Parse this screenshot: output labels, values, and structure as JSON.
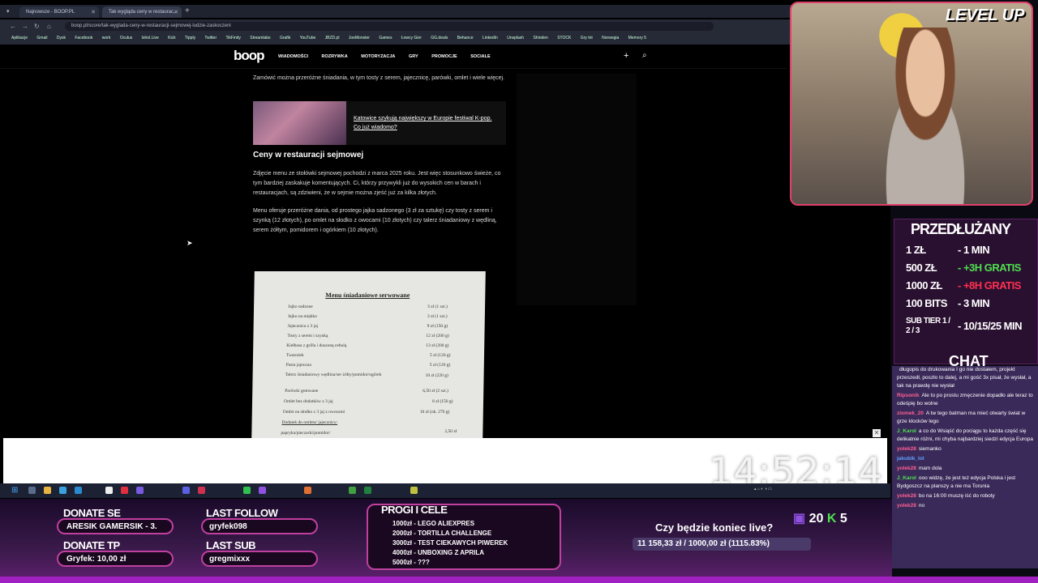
{
  "browser": {
    "tabs": [
      {
        "label": "Najnowsze - BOOP.PL"
      },
      {
        "label": "Tak wygląda ceny w restaurac..."
      }
    ],
    "url": "boop.pl/score/tak-wyglada-ceny-w-restauracji-sejmowej-ludzie-zaskoczeni",
    "bookmarks": [
      "Aplikacje",
      "Gmail",
      "Dysk",
      "Facebook",
      "work",
      "Oculus",
      "lolrol.Live",
      "Kick",
      "Tipply",
      "Twitter",
      "TikFinity",
      "Streamlabs",
      "Grafik",
      "YouTube",
      "JBZD.pl",
      "JoeMonster",
      "Games",
      "Łowcy Gier",
      "GG.deals",
      "Behance",
      "LinkedIn",
      "Unsplash",
      "Shinden",
      "STOCK",
      "Gry tnt",
      "Norwegia",
      "Memory 5"
    ]
  },
  "site": {
    "logo": "boop",
    "menu": [
      "WIADOMOŚCI",
      "ROZRYWKA",
      "MOTORYZACJA",
      "GRY",
      "PROMOCJE",
      "SOCIALE"
    ],
    "intro": "Zamówić można przeróżne śniadania, w tym tosty z serem, jajecznicę, parówki, omlet i wiele więcej.",
    "related_title": "Katowice szykują największy w Europie festiwal K-pop. Co już wiadomo?",
    "heading": "Ceny w restauracji sejmowej",
    "para1": "Zdjęcie menu ze stołówki sejmowej pochodzi z marca 2025 roku. Jest więc stosunkowo świeże, co tym bardziej zaskakuje komentujących. Ci, którzy przywykli już do wysokich cen w barach i restauracjach, są zdziwieni, że w sejmie można zjeść już za kilka złotych.",
    "para2": "Menu oferuje przeróżne dania, od prostego jajka sadzonego (3 zł za sztukę) czy tosty z serem i szynką (12 złotych), po omlet na słodko z owocami (10 złotych) czy talerz śniadaniowy z wędliną, serem żółtym, pomidorem i ogórkiem (10 złotych)."
  },
  "menu_photo": {
    "title": "Menu śniadaniowe serwowane",
    "items": [
      {
        "name": "Jajko sadzone",
        "price": "3 zł (1 szt.)"
      },
      {
        "name": "Jajko na miękko",
        "price": "3 zł (1 szt.)"
      },
      {
        "name": "Jajecznica z 3 jaj",
        "price": "9 zł (150 g)"
      },
      {
        "name": "Tosty z serem i szynką",
        "price": "12 zł (200 g)"
      },
      {
        "name": "Kiełbasa z grilla i duszoną cebulą",
        "price": "13 zł (200 g)"
      },
      {
        "name": "Twarożek",
        "price": "5 zł (120 g)"
      },
      {
        "name": "Pasta jajeczna",
        "price": "5 zł (120 g)"
      },
      {
        "name": "Talerz śniadaniowy wędlina/ser żółty/pomidor/ogórek",
        "price": "10 zł (220 g)"
      },
      {
        "name": "Parówki gotowane",
        "price": "6,50 zł (2 szt.)"
      },
      {
        "name": "Omlet bez dodatków z 3 jaj",
        "price": "8 zł (150 g)"
      },
      {
        "name": "Omlet na słodko z 3 jaj z owocami",
        "price": "10 zł (ok. 270 g)"
      },
      {
        "name": "Dodatek do omleta/ jajecznicy:",
        "price": ""
      },
      {
        "name": "papryka/pieczarki/pomidor/",
        "price": "2,50 zł"
      }
    ]
  },
  "overlay": {
    "clock": "14:52:14",
    "level_up": "LEVEL UP",
    "przedluzany": {
      "title": "PRZEDŁUŻANY",
      "rows": [
        {
          "left": "1 ZŁ",
          "right": "- 1 MIN"
        },
        {
          "left": "500 ZŁ",
          "right": "- +3H GRATIS"
        },
        {
          "left": "1000 ZŁ",
          "right": "- +8H GRATIS"
        },
        {
          "left": "100 BITS",
          "right": "- 3 MIN"
        },
        {
          "left": "SUB TIER 1 / 2 / 3",
          "right": "- 10/15/25 MIN"
        }
      ]
    },
    "chat_title": "CHAT",
    "chat": [
      {
        "name": "",
        "text": "długopis do drukowania I go nie dostałem, projekt przeszedł, poszło to dalej, a mi gość 3x pisał, że wysłał, a tak na prawdę nie wysłał"
      },
      {
        "name": "Ripsonik",
        "text": "Ale to po prostu zmęczenie dopadło ale teraz to odeśpię bo wolne"
      },
      {
        "name": "ziomek_20",
        "text": "A tw tego batman ma mieć otwarty świat w grze klocków lego"
      },
      {
        "name": "J_Karol",
        "text": "a co do Wsiąść do pociągu to każda część się delikatnie różni, mi chyba najbardziej siedzi edycja Europa"
      },
      {
        "name": "yolek28",
        "text": "siemanko"
      },
      {
        "name": "jakubik_lol",
        "text": ""
      },
      {
        "name": "yolek28",
        "text": "mam dola"
      },
      {
        "name": "J_Karol",
        "text": "ooo widzę, że jest też edycja Polska i jest Bydgoszcz na planszy a nie ma Torunia"
      },
      {
        "name": "yolek28",
        "text": "bo na 16:00 muszę iść do roboty"
      },
      {
        "name": "yolek28",
        "text": "no"
      }
    ],
    "donate_se_label": "DONATE SE",
    "donate_se_value": "ARESIK GAMERSIK - 3.",
    "donate_tp_label": "DONATE TP",
    "donate_tp_value": "Gryfek: 10,00 zł",
    "last_follow_label": "LAST FOLLOW",
    "last_follow_value": "gryfek098",
    "last_sub_label": "LAST SUB",
    "last_sub_value": "gregmixxx",
    "progi_title": "PROGI I CELE",
    "progi": [
      "1000zł - LEGO ALIEXPRES",
      "2000zł - TORTILLA CHALLENGE",
      "3000zł - TEST CIEKAWYCH PIWEREK",
      "4000zł - UNBOXING Z APRILA",
      "5000zł - ???"
    ],
    "goal_question": "Czy będzie koniec live?",
    "goal_value": "11 158,33 zł / 1000,00 zł (1115.83%)",
    "subs": "20",
    "kicks": "5"
  }
}
